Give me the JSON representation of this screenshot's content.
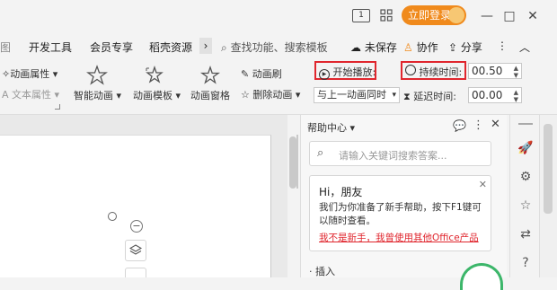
{
  "window": {
    "login_label": "立即登录",
    "counter": "1",
    "minimize": "—",
    "restore": "□",
    "close": "✕"
  },
  "menu": {
    "items": [
      "开发工具",
      "会员专享",
      "稻壳资源"
    ],
    "more": "›",
    "search_placeholder": "查找功能、搜索模板",
    "unsaved": "未保存",
    "collaborate": "协作",
    "share": "分享"
  },
  "ribbon": {
    "anim_attr": "动画属性",
    "text_attr": "文本属性",
    "smart_anim": "智能动画",
    "anim_template": "动画模板",
    "anim_pane": "动画窗格",
    "anim_brush": "动画刷",
    "delete_anim": "删除动画",
    "start_play_label": "开始播放:",
    "start_play_value": "与上一动画同时",
    "duration_label": "持续时间:",
    "duration_value": "00.50",
    "delay_label": "延迟时间:",
    "delay_value": "00.00"
  },
  "help": {
    "title": "帮助中心",
    "search_placeholder": "请输入关键词搜索答案...",
    "greeting": "Hi，朋友",
    "message_line1": "我们为你准备了新手帮助，按下F1键可",
    "message_line2": "以随时查看。",
    "link": "我不是新手，我曾使用其他Office产品",
    "section": "· 插入"
  },
  "colors": {
    "accent": "#f08a1c",
    "highlight": "#e0262e",
    "link": "#e0262e"
  }
}
